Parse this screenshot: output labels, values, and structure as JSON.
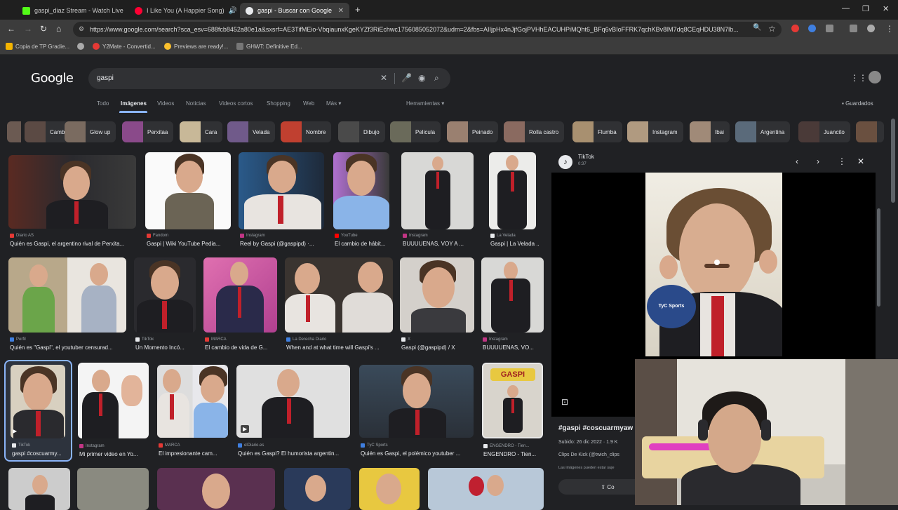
{
  "browser": {
    "tabs": [
      {
        "title": "gaspi_diaz Stream - Watch Live",
        "favicon_color": "#53fc18"
      },
      {
        "title": "I Like You (A Happier Song)",
        "favicon_color": "#ff0033"
      },
      {
        "title": "gaspi - Buscar con Google",
        "favicon_color": "#e8eaed"
      }
    ],
    "new_tab_icon": "plus-icon",
    "url": "https://www.google.com/search?sca_esv=688fcb8452a80e1a&sxsrf=AE3TifMEio-VbqiaunxKgeKYZf3RiEchwc1756085052072&udm=2&fbs=AIIjpHx4nJjfGojPVHhEACUHPiMQht6_BFq6vBIoFFRK7qchKBv8lM7dq8CEqHDU38N7lb...",
    "bookmarks": [
      {
        "label": "Copia de TP Gradie...",
        "color": "#f4b400"
      },
      {
        "label": "",
        "color": "#aaaaaa"
      },
      {
        "label": "Y2Mate - Convertid...",
        "color": "#e53935"
      },
      {
        "label": "Previews are ready!...",
        "color": "#fbc02d"
      },
      {
        "label": "GHWT: Definitive Ed...",
        "color": "#777777"
      }
    ]
  },
  "google": {
    "logo": "Google",
    "query": "gaspi",
    "nav_tabs": [
      "Todo",
      "Imágenes",
      "Videos",
      "Noticias",
      "Videos cortos",
      "Shopping",
      "Web",
      "Más ▾"
    ],
    "active_tab": "Imágenes",
    "tools": "Herramientas ▾",
    "saved": "Guardados",
    "chips": [
      "",
      "Cambio",
      "Glow up",
      "Perxitaa",
      "Cara",
      "Velada",
      "Nombre",
      "Dibujo",
      "Pelicula",
      "Peinado",
      "Rolla castro",
      "Flumba",
      "Instagram",
      "Ibai",
      "Argentina",
      "Juancito",
      ""
    ],
    "results": [
      {
        "source": "Diario AS",
        "title": "Quién es Gaspi, el argentino rival de Perxita..."
      },
      {
        "source": "Fandom",
        "title": "Gaspi | Wiki YouTube Pedia..."
      },
      {
        "source": "Instagram",
        "title": "Reel by Gaspi (@gaspipd) ·..."
      },
      {
        "source": "YouTube",
        "title": "El cambio de hábit..."
      },
      {
        "source": "Instagram",
        "title": "BUUUUENAS, VOY A ..."
      },
      {
        "source": "La Velada",
        "title": "Gaspi | La Velada ..."
      },
      {
        "source": "Perfil",
        "title": "Quién es \"Gaspi\", el youtuber censurad..."
      },
      {
        "source": "TikTok",
        "title": "Un Momento Incó..."
      },
      {
        "source": "MARCA",
        "title": "El cambio de vida de G..."
      },
      {
        "source": "La Derecha Diario",
        "title": "When and at what time will Gaspi's ..."
      },
      {
        "source": "X",
        "title": "Gaspi (@gaspipd) / X"
      },
      {
        "source": "Instagram",
        "title": "BUUUUENAS, VO..."
      },
      {
        "source": "TikTok",
        "title": "gaspi #coscuarmy..."
      },
      {
        "source": "Instagram",
        "title": "Mi primer video en Yo..."
      },
      {
        "source": "MARCA",
        "title": "El impresionante cam..."
      },
      {
        "source": "elDiario.es",
        "title": "Quién es Gaspi? El humorista argentin..."
      },
      {
        "source": "TyC Sports",
        "title": "Quién es Gaspi, el polémico youtuber ..."
      },
      {
        "source": "ENGENDRO - Tien...",
        "title": "ENGENDRO - Tien..."
      }
    ],
    "figure_text": "GASPI"
  },
  "panel": {
    "source": "TikTok",
    "duration": "0:37",
    "title": "#gaspi #coscuarmyaw",
    "meta": "Subido: 26 dic 2022 · 1.9 K",
    "clips": "Clips De Kick (@twich_clips",
    "note": "Las imágenes pueden estar suje",
    "share": "Co",
    "mic_text": "TyC Sports"
  }
}
